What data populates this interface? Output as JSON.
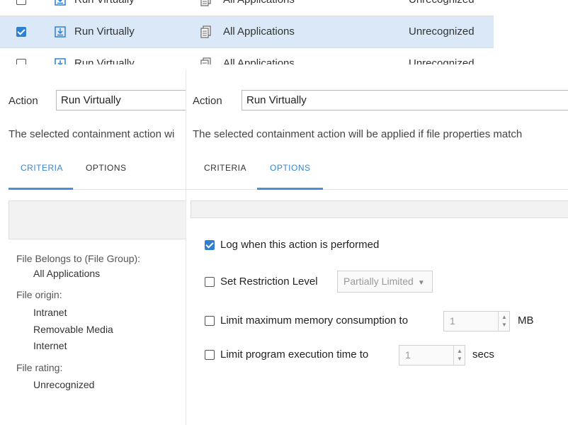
{
  "table": {
    "rows": [
      {
        "checked": false,
        "action": "Run Virtually",
        "group": "All Applications",
        "rating": "Unrecognized"
      },
      {
        "checked": true,
        "action": "Run Virtually",
        "group": "All Applications",
        "rating": "Unrecognized"
      },
      {
        "checked": false,
        "action": "Run Virtually",
        "group": "All Applications",
        "rating": "Unrecognized"
      }
    ]
  },
  "back_panel": {
    "action_label": "Action",
    "action_value": "Run Virtually",
    "description": "The selected containment action wi",
    "tabs": {
      "criteria": "CRITERIA",
      "options": "OPTIONS"
    },
    "criteria": {
      "file_group_heading": "File Belongs to (File Group):",
      "file_group_value": "All Applications",
      "origin_heading": "File origin:",
      "origin_values": [
        "Intranet",
        "Removable Media",
        "Internet"
      ],
      "rating_heading": "File rating:",
      "rating_value": "Unrecognized"
    }
  },
  "front_panel": {
    "action_label": "Action",
    "action_value": "Run Virtually",
    "description": "The selected containment action will be applied if file properties match",
    "tabs": {
      "criteria": "CRITERIA",
      "options": "OPTIONS"
    },
    "options": {
      "log": {
        "label": "Log when this action is performed",
        "checked": true
      },
      "restriction": {
        "label": "Set Restriction Level",
        "checked": false,
        "select_value": "Partially Limited"
      },
      "memory": {
        "label": "Limit maximum memory consumption to",
        "checked": false,
        "value": "1",
        "unit": "MB"
      },
      "exec_time": {
        "label": "Limit program execution time to",
        "checked": false,
        "value": "1",
        "unit": "secs"
      }
    }
  },
  "colors": {
    "accent": "#2f7fd0",
    "tab_active": "#3a86cc",
    "selected_row": "#dbe8f7"
  },
  "icons": {
    "action": "run-virtually-icon",
    "group": "file-group-icon"
  }
}
